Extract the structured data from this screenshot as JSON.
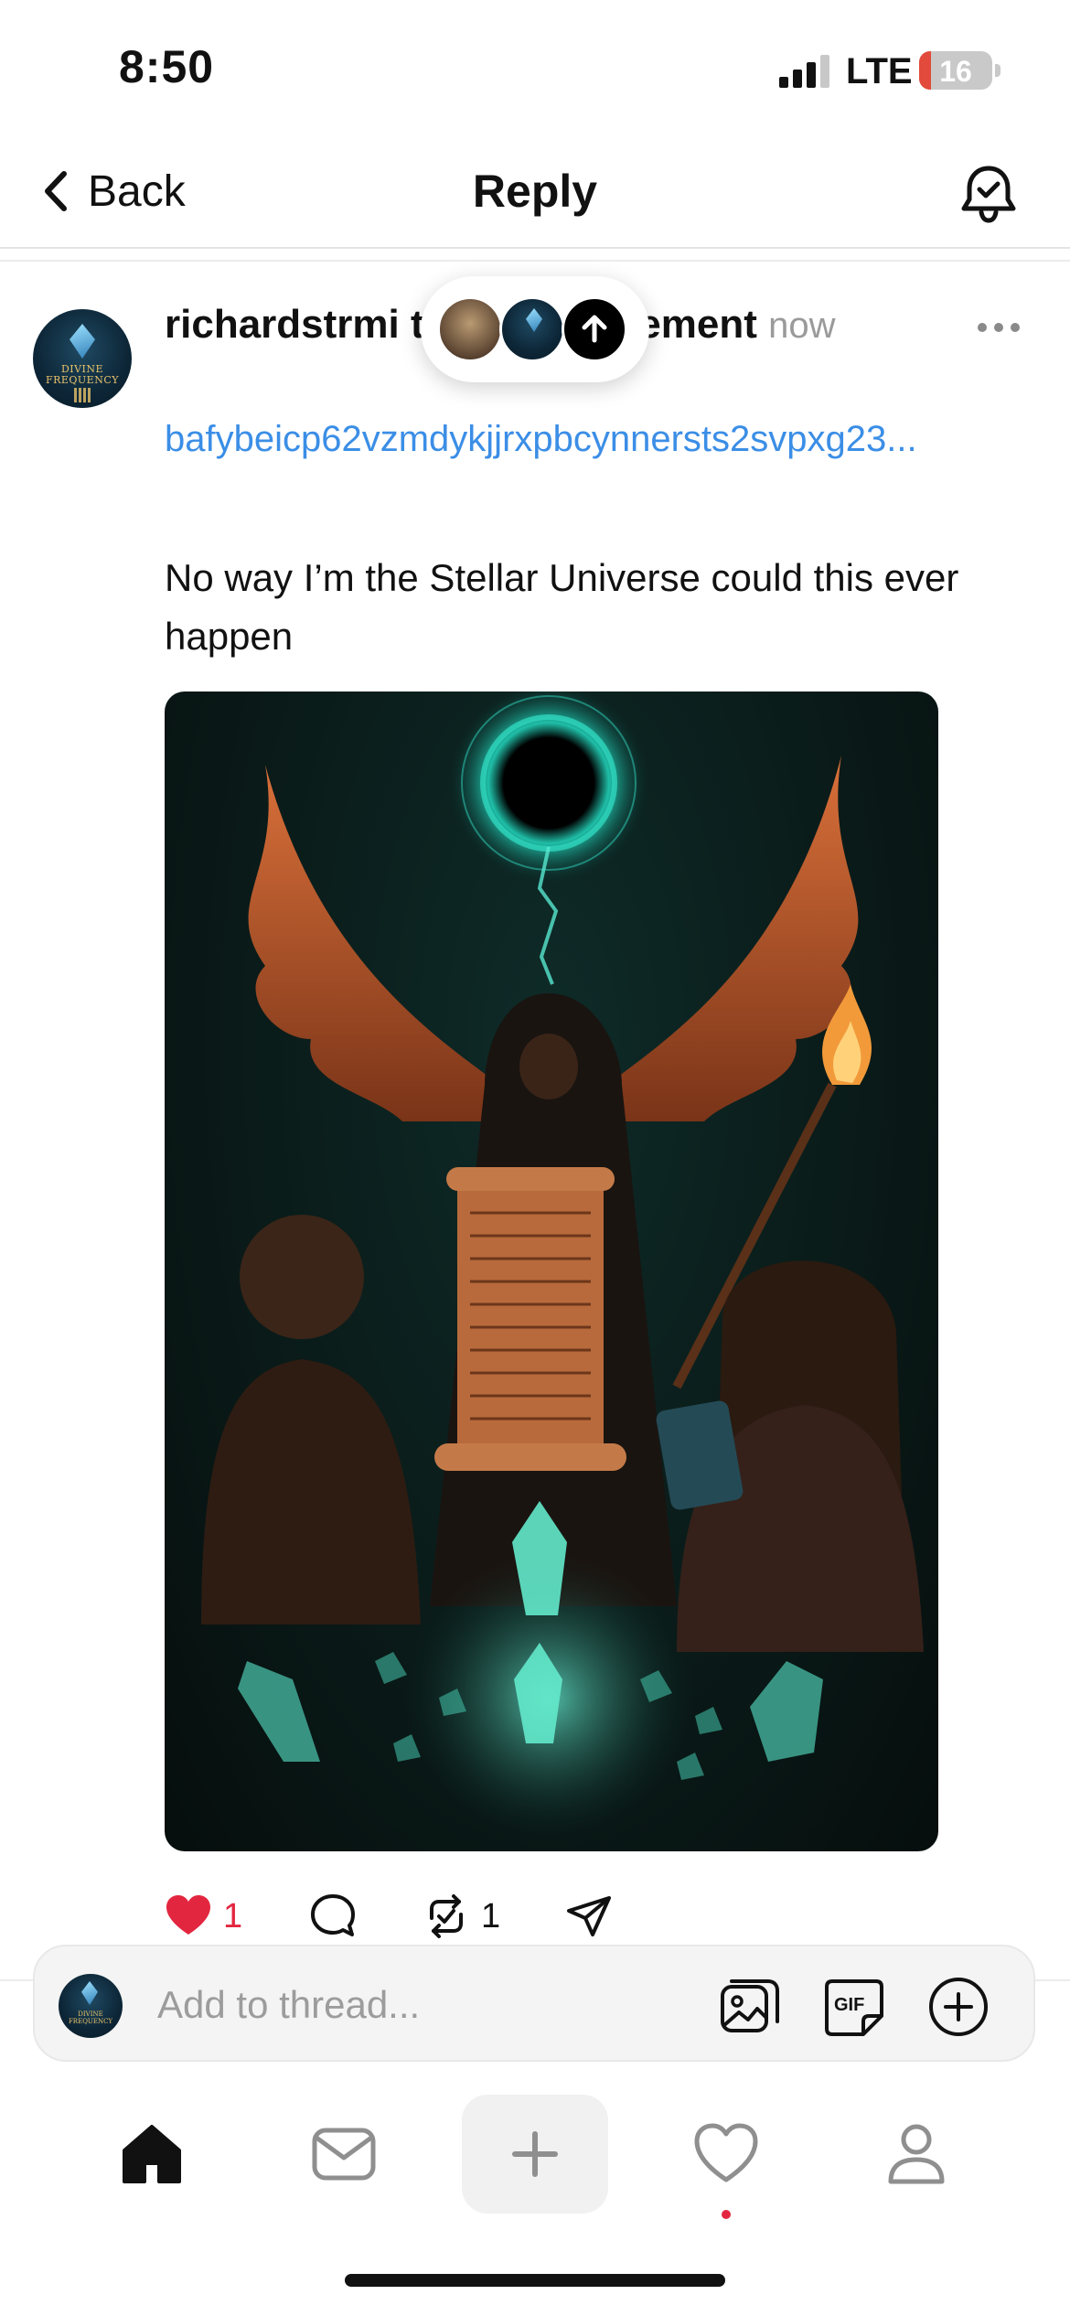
{
  "status_bar": {
    "time": "8:50",
    "network": "LTE",
    "battery_level": "16",
    "battery_fraction": 0.16,
    "signal_bars_active": 3,
    "signal_bars_total": 4
  },
  "header": {
    "back_label": "Back",
    "title": "Reply",
    "notification_icon": "bell-check-icon"
  },
  "post": {
    "author_line": "richardstrmi     tum entanglement",
    "time": "now",
    "link": "bafybeicp62vzmdykjjrxpbcynnersts2svpxg23...",
    "text": "No way I’m the Stellar Universe could this ever happen",
    "avatar_text": "DIVINE FREQUENCY",
    "more_icon": "more-horizontal-icon",
    "image_icon": "artwork-image",
    "actions": {
      "like_count": "1",
      "comment_count": "",
      "repost_count": "1",
      "like_color": "#e3263f"
    }
  },
  "participants": {
    "scroll_icon": "arrow-up-icon"
  },
  "composer": {
    "placeholder": "Add to thread...",
    "gif_label": "GIF"
  },
  "tabs": [
    {
      "name": "home",
      "icon": "home-icon",
      "active": true
    },
    {
      "name": "messages",
      "icon": "inbox-icon",
      "active": false
    },
    {
      "name": "create",
      "icon": "plus-icon",
      "active": false
    },
    {
      "name": "activity",
      "icon": "heart-icon",
      "active": false,
      "has_dot": true
    },
    {
      "name": "profile",
      "icon": "person-icon",
      "active": false
    }
  ],
  "colors": {
    "link": "#3b8ee6",
    "accent_red": "#e3263f",
    "muted": "#9a9a9a"
  }
}
